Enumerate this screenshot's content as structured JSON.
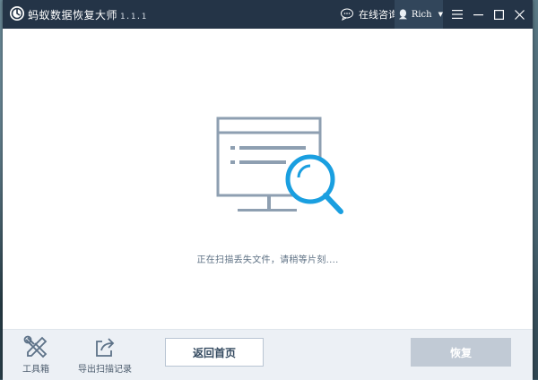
{
  "app": {
    "title": "蚂蚁数据恢复大师",
    "version": "1.1.1"
  },
  "header": {
    "consult_label": "在线咨询",
    "user_name": "Rich"
  },
  "main": {
    "status_text": "正在扫描丢失文件，请稍等片刻....",
    "illustration_icon": "monitor-search-icon"
  },
  "footer": {
    "tools": [
      {
        "label": "工具箱",
        "icon": "toolbox-icon"
      },
      {
        "label": "导出扫描记录",
        "icon": "export-icon"
      }
    ],
    "home_button": "返回首页",
    "recover_button": "恢复"
  },
  "colors": {
    "titlebar": "#243447",
    "accent": "#1a9fe0",
    "illustration": "#8e9fb1",
    "disabled_button": "#c1cad5"
  }
}
